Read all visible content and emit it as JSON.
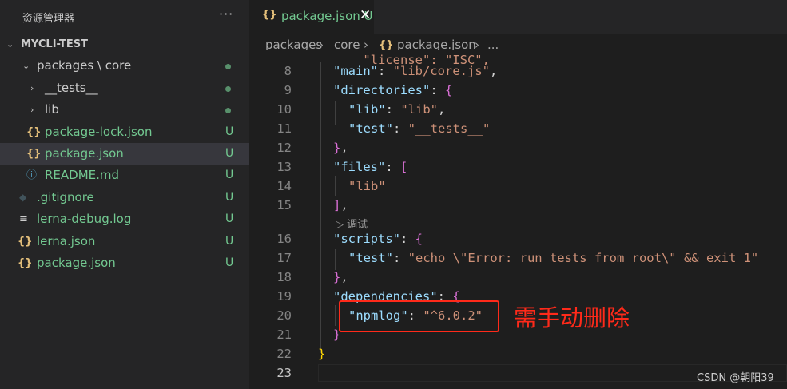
{
  "explorer": {
    "title": "资源管理器",
    "more": "···",
    "project": "MYCLI-TEST",
    "items": [
      {
        "chevron": "⌄",
        "icon": "",
        "label": "packages \\ core",
        "status": "dot"
      },
      {
        "chevron": "›",
        "icon": "",
        "label": "__tests__",
        "status": "dot"
      },
      {
        "chevron": "›",
        "icon": "",
        "label": "lib",
        "status": "dot"
      },
      {
        "chevron": "",
        "icon": "{}",
        "label": "package-lock.json",
        "status": "U"
      },
      {
        "chevron": "",
        "icon": "{}",
        "label": "package.json",
        "status": "U"
      },
      {
        "chevron": "",
        "icon": "ⓘ",
        "label": "README.md",
        "status": "U"
      },
      {
        "chevron": "",
        "icon": "◆",
        "label": ".gitignore",
        "status": "U"
      },
      {
        "chevron": "",
        "icon": "≡",
        "label": "lerna-debug.log",
        "status": "U"
      },
      {
        "chevron": "",
        "icon": "{}",
        "label": "lerna.json",
        "status": "U"
      },
      {
        "chevron": "",
        "icon": "{}",
        "label": "package.json",
        "status": "U"
      }
    ]
  },
  "tab": {
    "icon": "{}",
    "name": "package.json",
    "status": "U",
    "close": "✕"
  },
  "breadcrumb": {
    "p1": "packages",
    "sep": "›",
    "p2": "core",
    "icon": "{}",
    "p3": "package.json",
    "more": "..."
  },
  "code": {
    "partial_line": "\"license\": \"ISC\",",
    "line_numbers": [
      "8",
      "9",
      "10",
      "11",
      "12",
      "13",
      "14",
      "15",
      "16",
      "17",
      "18",
      "19",
      "20",
      "21",
      "22",
      "23"
    ],
    "codelens": "调试",
    "keys": {
      "main": "\"main\"",
      "main_val": "\"lib/core.js\"",
      "directories": "\"directories\"",
      "lib": "\"lib\"",
      "lib_val": "\"lib\"",
      "test": "\"test\"",
      "test_val": "\"__tests__\"",
      "files": "\"files\"",
      "files_item": "\"lib\"",
      "scripts": "\"scripts\"",
      "script_test": "\"test\"",
      "script_test_val": "\"echo \\\"Error: run tests from root\\\" && exit 1\"",
      "dependencies": "\"dependencies\"",
      "npmlog": "\"npmlog\"",
      "npmlog_val": "\"^6.0.2\""
    }
  },
  "annotation": "需手动删除",
  "watermark": "CSDN @朝阳39",
  "colors": {
    "key": "#9cdcfe",
    "string": "#ce9178",
    "annotation": "#ff2a1a",
    "untracked": "#73c991"
  }
}
